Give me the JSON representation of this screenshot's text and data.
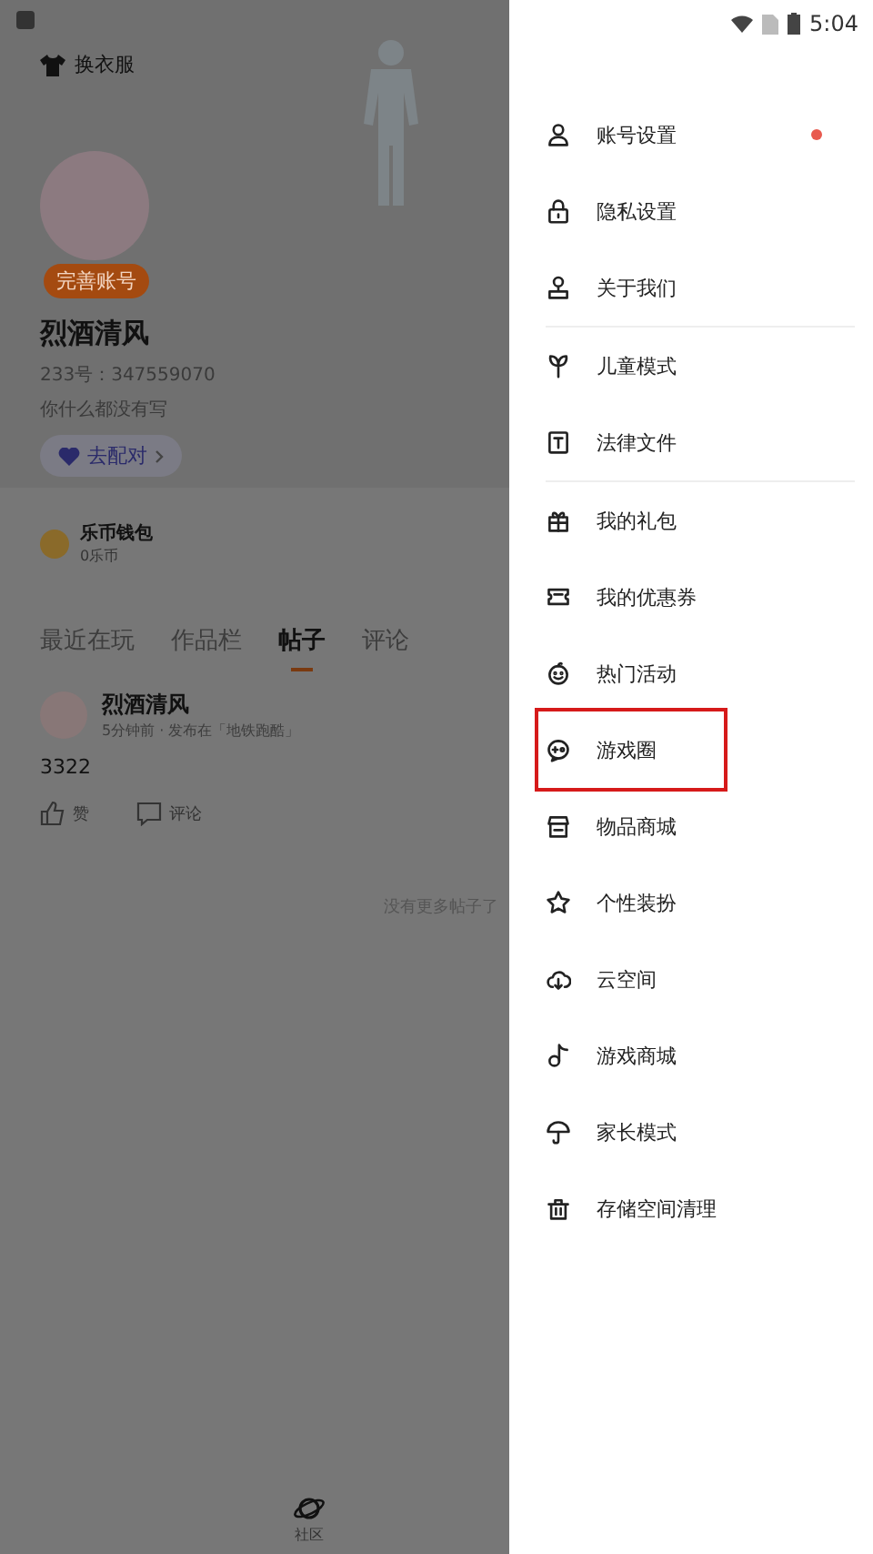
{
  "status_bar": {
    "time": "5:04"
  },
  "profile": {
    "outfit_button": "换衣服",
    "badge": "完善账号",
    "name": "烈酒清风",
    "id": "233号：347559070",
    "bio": "你什么都没有写",
    "pair_button": "去配对"
  },
  "wallet": {
    "title": "乐币钱包",
    "balance": "0乐币"
  },
  "tabs": [
    {
      "label": "最近在玩",
      "selected": false
    },
    {
      "label": "作品栏",
      "selected": false
    },
    {
      "label": "帖子",
      "selected": true
    },
    {
      "label": "评论",
      "selected": false
    }
  ],
  "post": {
    "author": "烈酒清风",
    "meta": "5分钟前 · 发布在「地铁跑酷」",
    "text": "3322",
    "like": "赞",
    "comment": "评论"
  },
  "end_note": "没有更多帖子了",
  "bottom_nav": [
    {
      "label": "社区"
    }
  ],
  "menu": {
    "groups": [
      [
        {
          "label": "账号设置",
          "badge": true,
          "highlighted": false
        },
        {
          "label": "隐私设置",
          "badge": false,
          "highlighted": false
        },
        {
          "label": "关于我们",
          "badge": false,
          "highlighted": false
        }
      ],
      [
        {
          "label": "儿童模式",
          "badge": false,
          "highlighted": false
        },
        {
          "label": "法律文件",
          "badge": false,
          "highlighted": false
        }
      ],
      [
        {
          "label": "我的礼包",
          "badge": false,
          "highlighted": false
        },
        {
          "label": "我的优惠券",
          "badge": false,
          "highlighted": false
        },
        {
          "label": "热门活动",
          "badge": false,
          "highlighted": false
        },
        {
          "label": "游戏圈",
          "badge": false,
          "highlighted": true
        },
        {
          "label": "物品商城",
          "badge": false,
          "highlighted": false
        },
        {
          "label": "个性装扮",
          "badge": false,
          "highlighted": false
        },
        {
          "label": "云空间",
          "badge": false,
          "highlighted": false
        },
        {
          "label": "游戏商城",
          "badge": false,
          "highlighted": false
        },
        {
          "label": "家长模式",
          "badge": false,
          "highlighted": false
        },
        {
          "label": "存储空间清理",
          "badge": false,
          "highlighted": false
        }
      ]
    ]
  }
}
